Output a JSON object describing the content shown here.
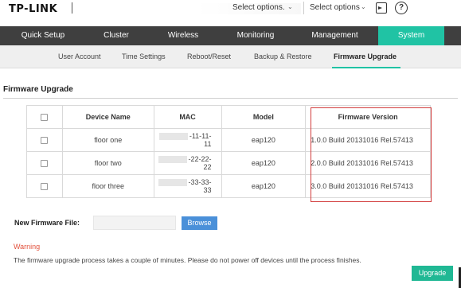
{
  "header": {
    "brand": "TP-LINK",
    "select1": "Select options.",
    "select2": "Select options"
  },
  "mainnav": [
    {
      "label": "Quick Setup"
    },
    {
      "label": "Cluster"
    },
    {
      "label": "Wireless"
    },
    {
      "label": "Monitoring"
    },
    {
      "label": "Management"
    },
    {
      "label": "System",
      "active": true
    }
  ],
  "subnav": [
    {
      "label": "User Account"
    },
    {
      "label": "Time Settings"
    },
    {
      "label": "Reboot/Reset"
    },
    {
      "label": "Backup & Restore"
    },
    {
      "label": "Firmware Upgrade",
      "active": true
    }
  ],
  "section": {
    "title": "Firmware Upgrade"
  },
  "table": {
    "headers": [
      "",
      "Device Name",
      "MAC",
      "Model",
      "Firmware Version"
    ],
    "rows": [
      {
        "name": "floor one",
        "mac": "-11-11-11",
        "model": "eap120",
        "firmware": "1.0.0 Build 20131016 Rel.57413"
      },
      {
        "name": "floor two",
        "mac": "-22-22-22",
        "model": "eap120",
        "firmware": "2.0.0 Build 20131016 Rel.57413"
      },
      {
        "name": "floor three",
        "mac": "-33-33-33",
        "model": "eap120",
        "firmware": "3.0.0 Build 20131016 Rel.57413"
      }
    ]
  },
  "firmware_file": {
    "label": "New Firmware File:",
    "value": "",
    "browse": "Browse"
  },
  "warning": {
    "title": "Warning",
    "text": "The firmware upgrade process takes a couple of minutes. Please do not power off devices until the process finishes."
  },
  "upgrade": "Upgrade",
  "colors": {
    "accent": "#20c3a4",
    "nav_bg": "#3f3f3f",
    "highlight": "#d23c3c",
    "browse": "#4a90d9",
    "warning": "#e2513c"
  },
  "icons": {
    "select_chevron": "chevron-down-icon",
    "logout": "logout-icon",
    "help": "help-icon",
    "checkbox": "checkbox-icon"
  }
}
